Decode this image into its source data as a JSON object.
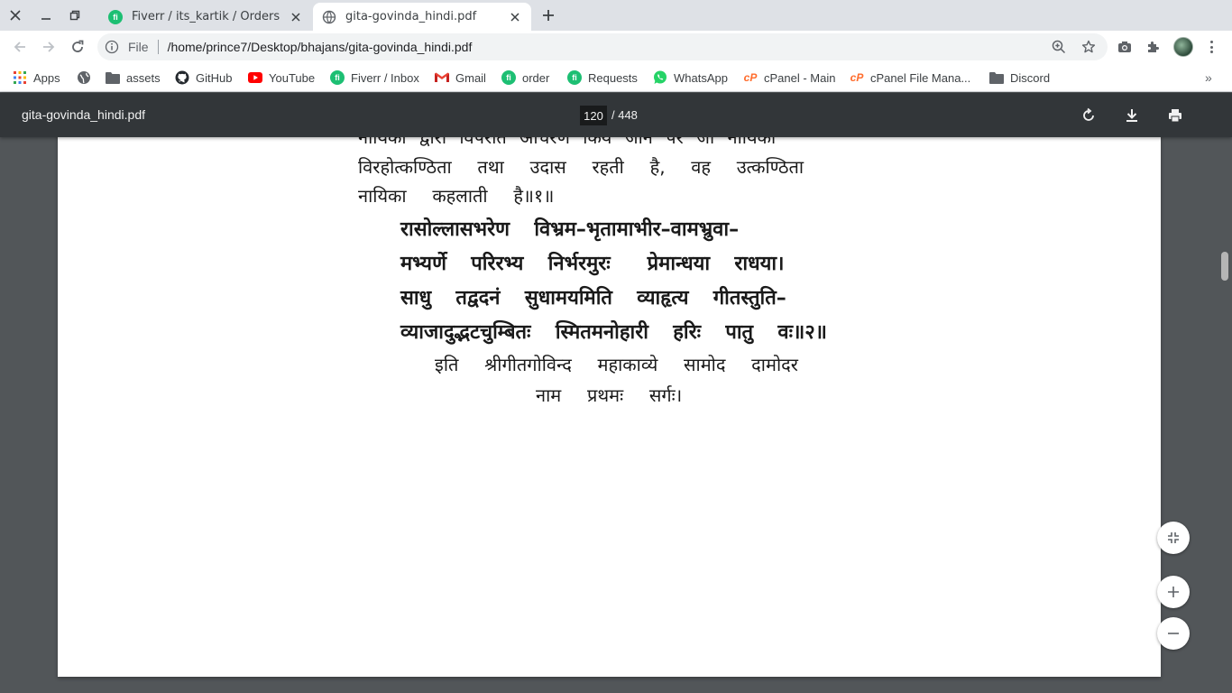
{
  "browser": {
    "tabs": [
      {
        "title": "Fiverr / its_kartik / Orders ma",
        "favicon": "fiverr-icon",
        "active": false
      },
      {
        "title": "gita-govinda_hindi.pdf",
        "favicon": "globe-icon",
        "active": true
      }
    ],
    "omnibox": {
      "scheme": "File",
      "url": "/home/prince7/Desktop/bhajans/gita-govinda_hindi.pdf"
    },
    "bookmarks": [
      {
        "label": "Apps",
        "icon": "apps-grid-icon"
      },
      {
        "label": "",
        "icon": "globe-icon"
      },
      {
        "label": "assets",
        "icon": "folder-icon"
      },
      {
        "label": "GitHub",
        "icon": "github-icon"
      },
      {
        "label": "YouTube",
        "icon": "youtube-icon"
      },
      {
        "label": "Fiverr / Inbox",
        "icon": "fiverr-icon"
      },
      {
        "label": "Gmail",
        "icon": "gmail-icon"
      },
      {
        "label": "order",
        "icon": "fiverr-icon"
      },
      {
        "label": "Requests",
        "icon": "fiverr-icon"
      },
      {
        "label": "WhatsApp",
        "icon": "whatsapp-icon"
      },
      {
        "label": "cPanel - Main",
        "icon": "cpanel-icon"
      },
      {
        "label": "cPanel File Mana...",
        "icon": "cpanel-icon"
      },
      {
        "label": "Discord",
        "icon": "folder-icon"
      }
    ],
    "bookmarks_overflow": "»"
  },
  "pdf": {
    "title": "gita-govinda_hindi.pdf",
    "current_page": "120",
    "total_pages": "/ 448",
    "lines": [
      "नायिका द्वारा विपरीत आचरण किये जाने पर जो नायिका",
      "विरहोत्कण्ठिता  तथा  उदास  रहती  है,  वह  उत्कण्ठिता",
      "नायिका  कहलाती  है॥१॥",
      "रासोल्लासभरेण  विभ्रम–भृतामाभीर–वामभ्रुवा–",
      "मभ्यर्णे  परिरभ्य  निर्भरमुरः   प्रेमान्धया  राधया।",
      "साधु  तद्वदनं  सुधामयमिति  व्याहृत्य  गीतस्तुति–",
      "व्याजादुद्भटचुम्बितः  स्मितमनोहारी  हरिः  पातु  वः॥२॥",
      "इति  श्रीगीतगोविन्द  महाकाव्ये  सामोद  दामोदर",
      "नाम  प्रथमः  सर्गः।"
    ]
  },
  "colors": {
    "tabstrip_bg": "#dee1e6",
    "pdf_toolbar_bg": "#323639",
    "viewer_bg": "#525659",
    "fiverr_green": "#1dbf73",
    "youtube_red": "#ff0000",
    "cpanel_orange": "#ff6c2c",
    "whatsapp_green": "#25d366"
  }
}
